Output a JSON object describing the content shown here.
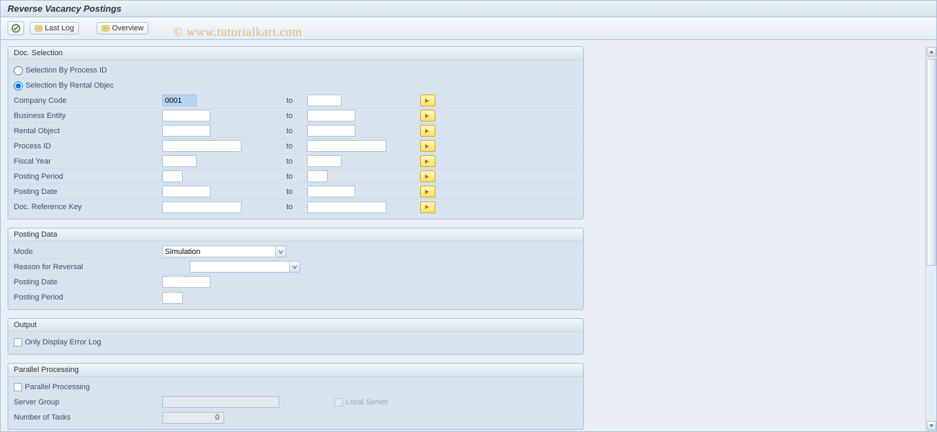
{
  "title": "Reverse Vacancy Postings",
  "toolbar": {
    "execute_label": "",
    "lastlog_label": "Last Log",
    "overview_label": "Overview"
  },
  "watermark": "© www.tutorialkart.com",
  "groups": {
    "doc_sel": {
      "title": "Doc. Selection",
      "radio_process": "Selection By Process ID",
      "radio_rental": "Selection By Rental Objec",
      "rows": {
        "company_code": {
          "label": "Company Code",
          "from": "0001",
          "to": ""
        },
        "business_entity": {
          "label": "Business Entity",
          "from": "",
          "to": ""
        },
        "rental_object": {
          "label": "Rental Object",
          "from": "",
          "to": ""
        },
        "process_id": {
          "label": "Process ID",
          "from": "",
          "to": ""
        },
        "fiscal_year": {
          "label": "Fiscal Year",
          "from": "",
          "to": ""
        },
        "posting_period": {
          "label": "Posting Period",
          "from": "",
          "to": ""
        },
        "posting_date": {
          "label": "Posting Date",
          "from": "",
          "to": ""
        },
        "doc_ref_key": {
          "label": "Doc. Reference Key",
          "from": "",
          "to": ""
        }
      },
      "to_label": "to"
    },
    "posting_data": {
      "title": "Posting Data",
      "mode_label": "Mode",
      "mode_value": "Simulation",
      "reason_label": "Reason for Reversal",
      "reason_value": "",
      "posting_date_label": "Posting Date",
      "posting_date_value": "",
      "posting_period_label": "Posting Period",
      "posting_period_value": ""
    },
    "output": {
      "title": "Output",
      "only_error_log": "Only Display Error Log"
    },
    "parallel": {
      "title": "Parallel Processing",
      "parallel_chk": "Parallel Processing",
      "server_group_label": "Server Group",
      "server_group_value": "",
      "local_server": "Local Server",
      "num_tasks_label": "Number of Tasks",
      "num_tasks_value": "0"
    }
  }
}
